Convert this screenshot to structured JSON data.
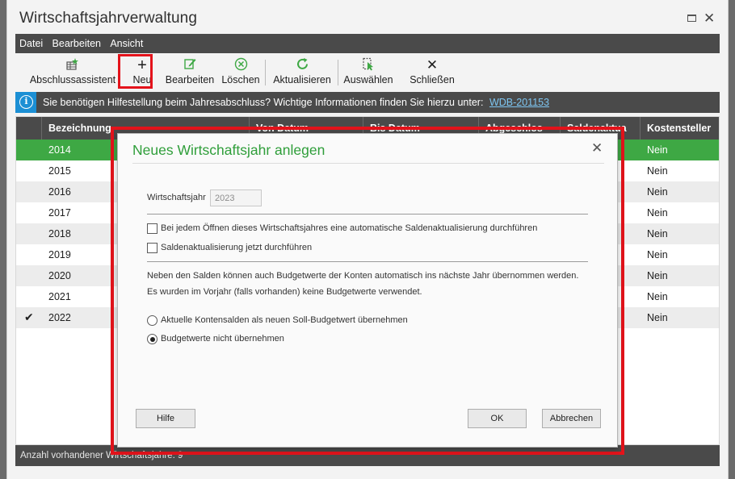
{
  "window": {
    "title": "Wirtschaftsjahrverwaltung"
  },
  "menu": [
    "Datei",
    "Bearbeiten",
    "Ansicht"
  ],
  "toolbar": {
    "buttons": [
      {
        "label": "Abschlussassistent",
        "icon": "wizard-icon"
      },
      {
        "label": "Neu",
        "icon": "plus-icon"
      },
      {
        "label": "Bearbeiten",
        "icon": "edit-icon"
      },
      {
        "label": "Löschen",
        "icon": "delete-icon"
      },
      {
        "label": "Aktualisieren",
        "icon": "refresh-icon"
      },
      {
        "label": "Auswählen",
        "icon": "select-icon"
      },
      {
        "label": "Schließen",
        "icon": "close-icon"
      }
    ]
  },
  "info": {
    "text": "Sie benötigen Hilfestellung beim Jahresabschluss? Wichtige Informationen finden Sie hierzu unter:",
    "link": "WDB-201153"
  },
  "grid": {
    "columns": [
      "Bezeichnung",
      "Von Datum",
      "Bis Datum",
      "Abgeschlos",
      "Saldenaktua",
      "Kostensteller"
    ],
    "rows": [
      {
        "bezeichnung": "2014",
        "kostensteller": "Nein",
        "current": false,
        "selected": true
      },
      {
        "bezeichnung": "2015",
        "kostensteller": "Nein",
        "current": false,
        "selected": false
      },
      {
        "bezeichnung": "2016",
        "kostensteller": "Nein",
        "current": false,
        "selected": false
      },
      {
        "bezeichnung": "2017",
        "kostensteller": "Nein",
        "current": false,
        "selected": false
      },
      {
        "bezeichnung": "2018",
        "kostensteller": "Nein",
        "current": false,
        "selected": false
      },
      {
        "bezeichnung": "2019",
        "kostensteller": "Nein",
        "current": false,
        "selected": false
      },
      {
        "bezeichnung": "2020",
        "kostensteller": "Nein",
        "current": false,
        "selected": false
      },
      {
        "bezeichnung": "2021",
        "kostensteller": "Nein",
        "current": false,
        "selected": false
      },
      {
        "bezeichnung": "2022",
        "kostensteller": "Nein",
        "current": true,
        "selected": false
      }
    ]
  },
  "status": {
    "text": "Anzahl vorhandener Wirtschaftsjahre: 9"
  },
  "dialog": {
    "title": "Neues Wirtschaftsjahr anlegen",
    "field_label": "Wirtschaftsjahr",
    "field_value": "2023",
    "checkbox1": "Bei jedem Öffnen dieses Wirtschaftsjahres eine automatische Saldenaktualisierung durchführen",
    "checkbox2": "Saldenaktualisierung jetzt durchführen",
    "para1": "Neben den Salden können auch Budgetwerte der Konten automatisch ins nächste Jahr übernommen werden.",
    "para2": "Es wurden im Vorjahr (falls vorhanden) keine Budgetwerte verwendet.",
    "radio1": "Aktuelle Kontensalden als neuen Soll-Budgetwert übernehmen",
    "radio2": "Budgetwerte nicht übernehmen",
    "radio_selected": 2,
    "btn_help": "Hilfe",
    "btn_ok": "OK",
    "btn_cancel": "Abbrechen"
  },
  "colors": {
    "accent": "#3ea844",
    "highlight": "#e4131b",
    "info": "#1c8fd4",
    "bar": "#4a4a4a"
  }
}
